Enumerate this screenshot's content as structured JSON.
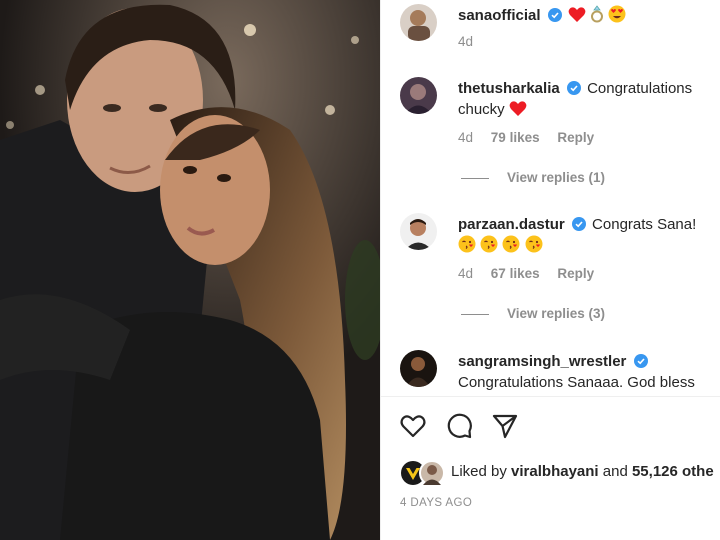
{
  "post": {
    "author": "sanaofficial",
    "caption_emojis": [
      "red-heart",
      "ring",
      "smiling-face-with-heart-eyes"
    ],
    "age": "4d"
  },
  "comments": [
    {
      "username": "thetusharkalia",
      "text": "Congratulations",
      "text_line2": "chucky",
      "emoji": "red-heart",
      "age": "4d",
      "likes": "79 likes",
      "reply": "Reply",
      "view_replies": "View replies (1)"
    },
    {
      "username": "parzaan.dastur",
      "text": "Congrats Sana!",
      "emojis": [
        "face-blowing-kiss",
        "face-blowing-kiss",
        "face-blowing-kiss",
        "face-blowing-kiss"
      ],
      "age": "4d",
      "likes": "67 likes",
      "reply": "Reply",
      "view_replies": "View replies (3)"
    },
    {
      "username": "sangramsingh_wrestler",
      "text": "Congratulations Sanaaa. God bless"
    }
  ],
  "liked_by": {
    "prefix": "Liked by",
    "user": "viralbhayani",
    "middle": "and",
    "count": "55,126 othe"
  },
  "post_date": "4 DAYS AGO",
  "colors": {
    "verified": "#3897f0",
    "heart": "#ed1c24",
    "muted": "#8e8e8e"
  },
  "icons": [
    "heart-icon",
    "comment-icon",
    "share-icon",
    "verified-badge-icon"
  ]
}
